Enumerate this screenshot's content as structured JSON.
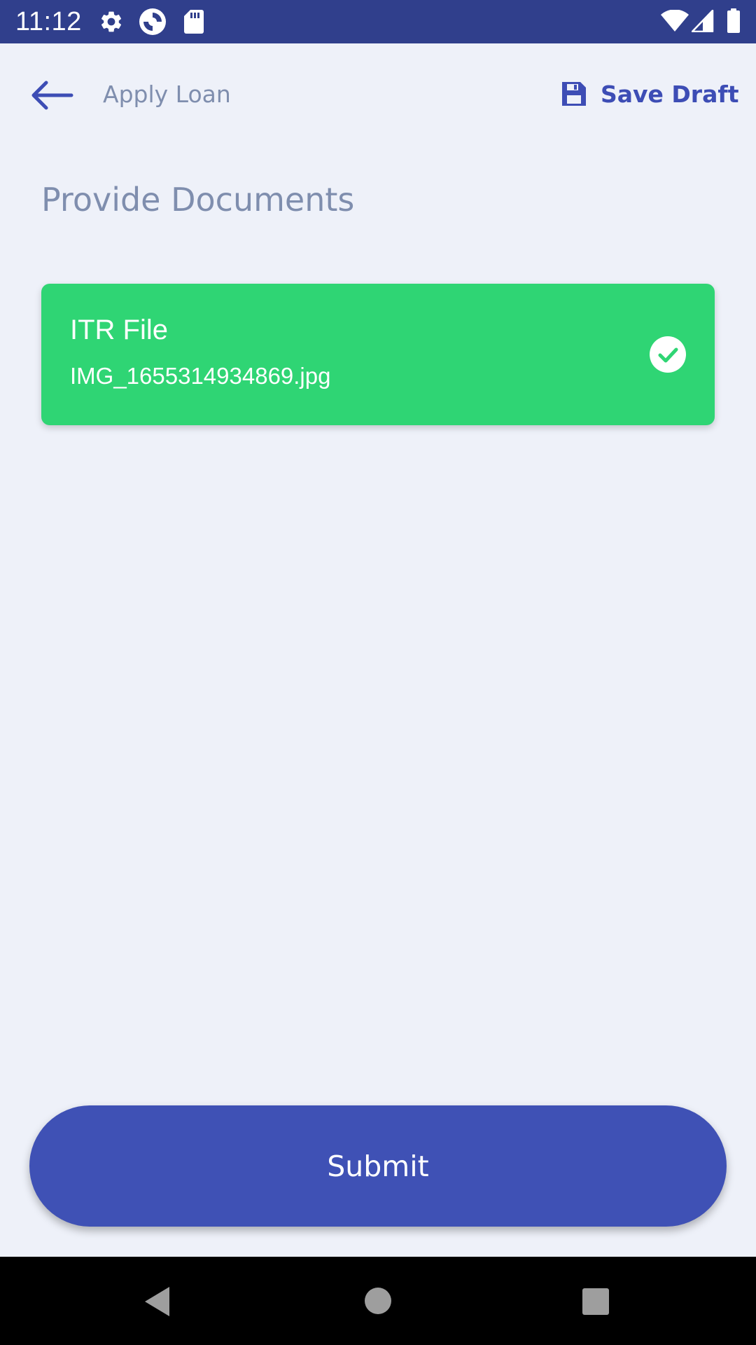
{
  "status_bar": {
    "time": "11:12",
    "left_icons": [
      "settings-icon",
      "sync-app-icon",
      "sd-card-icon"
    ],
    "right_icons": [
      "wifi-icon",
      "cell-signal-icon",
      "battery-icon"
    ]
  },
  "app_bar": {
    "back_icon": "arrow-left-icon",
    "title": "Apply Loan",
    "save_draft": {
      "icon": "floppy-disk-icon",
      "label": "Save Draft"
    }
  },
  "section": {
    "heading": "Provide Documents"
  },
  "documents": [
    {
      "title": "ITR File",
      "filename": "IMG_1655314934869.jpg",
      "status_icon": "check-circle-icon",
      "uploaded": true
    }
  ],
  "submit": {
    "label": "Submit"
  },
  "nav_bar": {
    "buttons": [
      "back-triangle-icon",
      "home-circle-icon",
      "recents-square-icon"
    ]
  },
  "colors": {
    "status_bar": "#303F8C",
    "background": "#EEF1F9",
    "accent": "#3F51B5",
    "muted_text": "#7F8EAE",
    "success": "#2FD574"
  }
}
